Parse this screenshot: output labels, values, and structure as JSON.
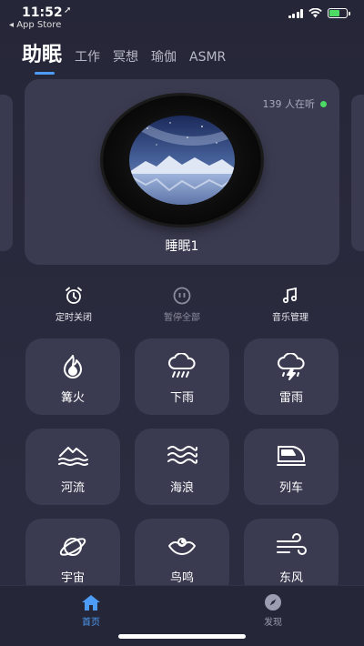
{
  "status_bar": {
    "time": "11:52",
    "location_glyph": "➚",
    "back_link": "◂ App Store"
  },
  "tabs": [
    {
      "label": "助眠",
      "active": true
    },
    {
      "label": "工作",
      "active": false
    },
    {
      "label": "冥想",
      "active": false
    },
    {
      "label": "瑜伽",
      "active": false
    },
    {
      "label": "ASMR",
      "active": false
    }
  ],
  "player": {
    "listeners": "139 人在听",
    "track_name": "睡眠1"
  },
  "controls": {
    "timer_label": "定时关闭",
    "pause_all_label": "暂停全部",
    "music_manage_label": "音乐管理"
  },
  "sounds": [
    {
      "label": "篝火",
      "icon": "campfire-icon"
    },
    {
      "label": "下雨",
      "icon": "rain-icon"
    },
    {
      "label": "雷雨",
      "icon": "thunderstorm-icon"
    },
    {
      "label": "河流",
      "icon": "river-icon"
    },
    {
      "label": "海浪",
      "icon": "waves-icon"
    },
    {
      "label": "列车",
      "icon": "train-icon"
    },
    {
      "label": "宇宙",
      "icon": "planet-icon"
    },
    {
      "label": "鸟鸣",
      "icon": "bird-icon"
    },
    {
      "label": "东风",
      "icon": "wind-icon"
    }
  ],
  "tabbar": {
    "home_label": "首页",
    "discover_label": "发现"
  },
  "colors": {
    "accent": "#4d9cf6",
    "live_dot": "#4cd964",
    "card": "#3a3b50",
    "background": "#252637"
  }
}
